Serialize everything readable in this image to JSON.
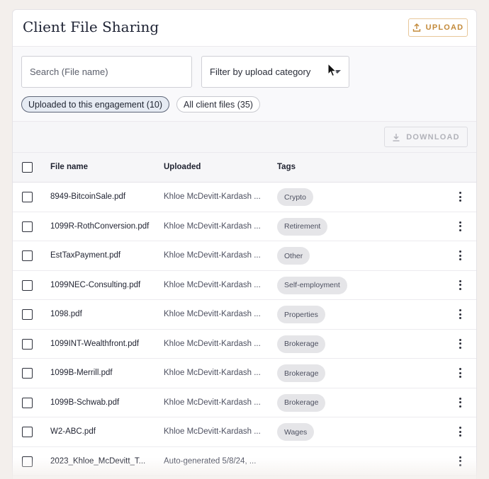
{
  "header": {
    "title": "Client File Sharing",
    "upload_label": "UPLOAD"
  },
  "filters": {
    "search_placeholder": "Search (File name)",
    "category_select": "Filter by upload category",
    "chips": [
      {
        "label": "Uploaded to this engagement (10)",
        "active": true
      },
      {
        "label": "All client files (35)",
        "active": false
      }
    ]
  },
  "toolbar": {
    "download_label": "DOWNLOAD"
  },
  "table": {
    "columns": {
      "file_name": "File name",
      "uploaded": "Uploaded",
      "tags": "Tags"
    },
    "rows": [
      {
        "file": "8949-BitcoinSale.pdf",
        "uploaded": "Khloe McDevitt-Kardash ...",
        "tag": "Crypto"
      },
      {
        "file": "1099R-RothConversion.pdf",
        "uploaded": "Khloe McDevitt-Kardash ...",
        "tag": "Retirement"
      },
      {
        "file": "EstTaxPayment.pdf",
        "uploaded": "Khloe McDevitt-Kardash ...",
        "tag": "Other"
      },
      {
        "file": "1099NEC-Consulting.pdf",
        "uploaded": "Khloe McDevitt-Kardash ...",
        "tag": "Self-employment"
      },
      {
        "file": "1098.pdf",
        "uploaded": "Khloe McDevitt-Kardash ...",
        "tag": "Properties"
      },
      {
        "file": "1099INT-Wealthfront.pdf",
        "uploaded": "Khloe McDevitt-Kardash ...",
        "tag": "Brokerage"
      },
      {
        "file": "1099B-Merrill.pdf",
        "uploaded": "Khloe McDevitt-Kardash ...",
        "tag": "Brokerage"
      },
      {
        "file": "1099B-Schwab.pdf",
        "uploaded": "Khloe McDevitt-Kardash ...",
        "tag": "Brokerage"
      },
      {
        "file": "W2-ABC.pdf",
        "uploaded": "Khloe McDevitt-Kardash ...",
        "tag": "Wages"
      },
      {
        "file": "2023_Khloe_McDevitt_T...",
        "uploaded": "Auto-generated 5/8/24, ...",
        "tag": ""
      }
    ]
  },
  "colors": {
    "accent": "#c38a3a",
    "active_chip_bg": "#e6ebf3",
    "tag_bg": "#e5e5e8"
  }
}
